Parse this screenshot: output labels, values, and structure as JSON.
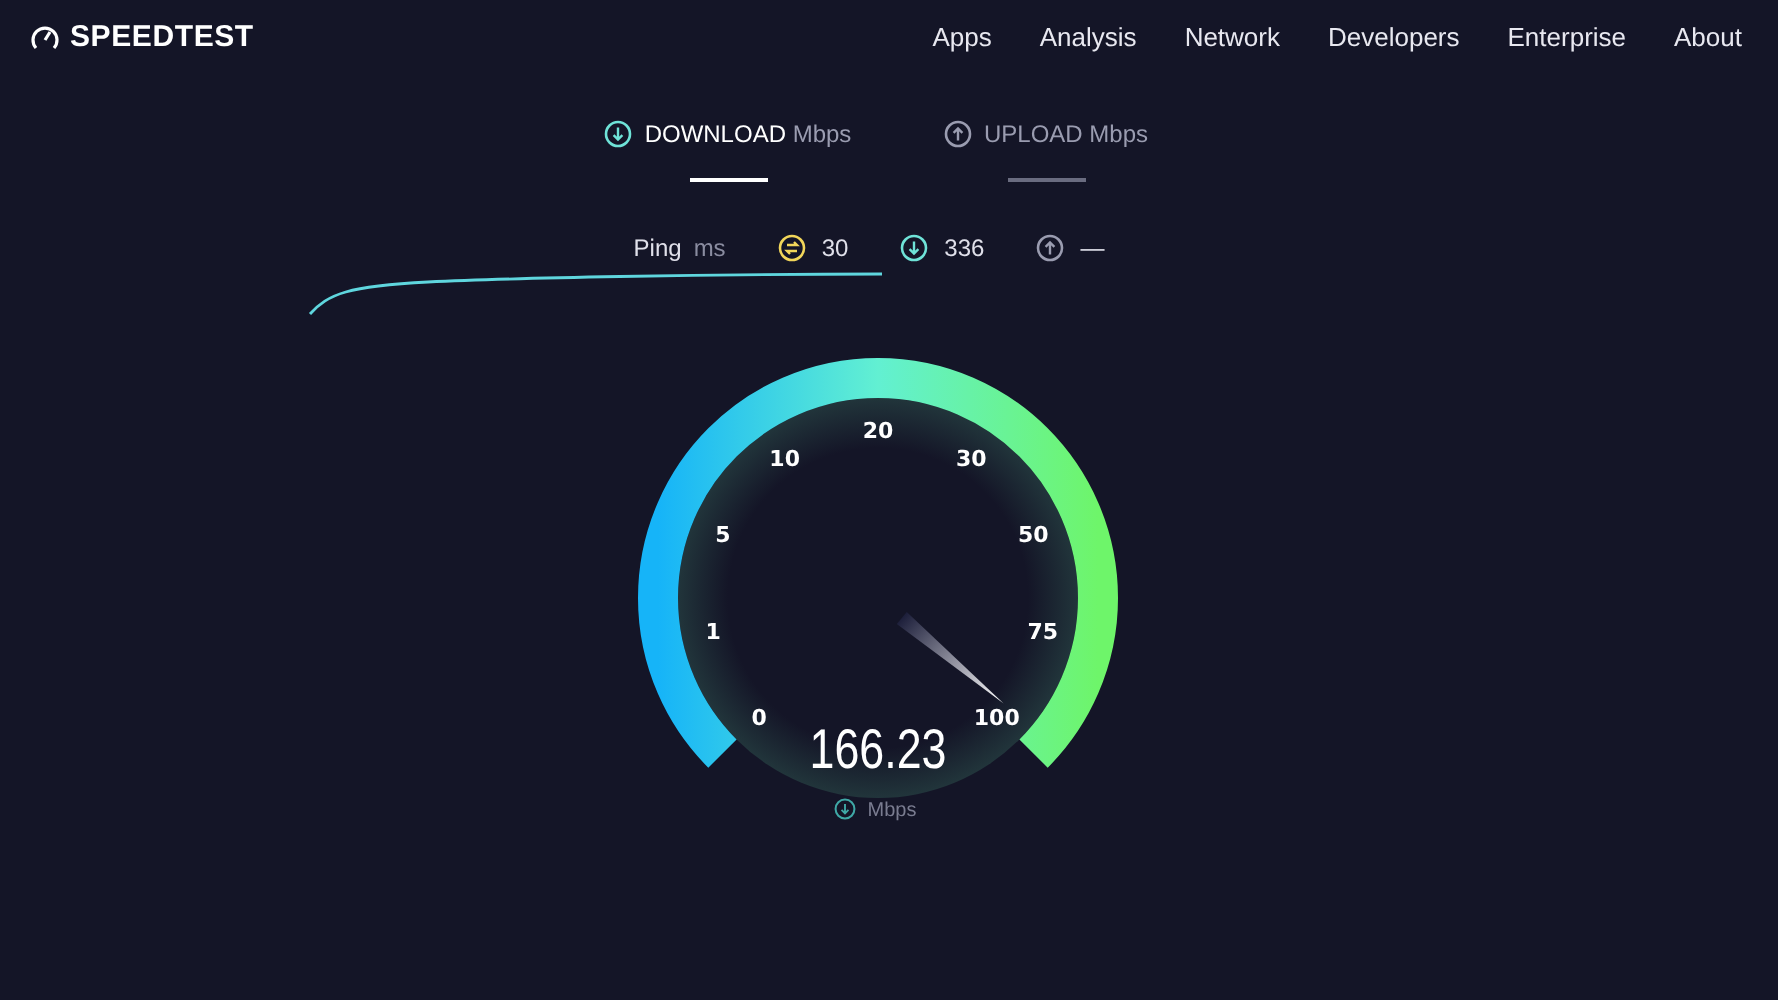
{
  "header": {
    "logo": "SPEEDTEST",
    "nav": [
      "Apps",
      "Analysis",
      "Network",
      "Developers",
      "Enterprise",
      "About"
    ]
  },
  "tabs": [
    {
      "label": "DOWNLOAD",
      "unit": "Mbps",
      "kind": "down",
      "selected": true
    },
    {
      "label": "UPLOAD",
      "unit": "Mbps",
      "kind": "up",
      "selected": false
    }
  ],
  "stats": {
    "label": "Ping",
    "unit": "ms",
    "items": [
      {
        "kind": "ping",
        "value": "30"
      },
      {
        "kind": "down",
        "value": "336"
      },
      {
        "kind": "up",
        "value": "—"
      }
    ]
  },
  "gauge": {
    "ticks": [
      "0",
      "1",
      "5",
      "10",
      "20",
      "30",
      "50",
      "75",
      "100"
    ],
    "value": "166.23",
    "unit": "Mbps"
  }
}
